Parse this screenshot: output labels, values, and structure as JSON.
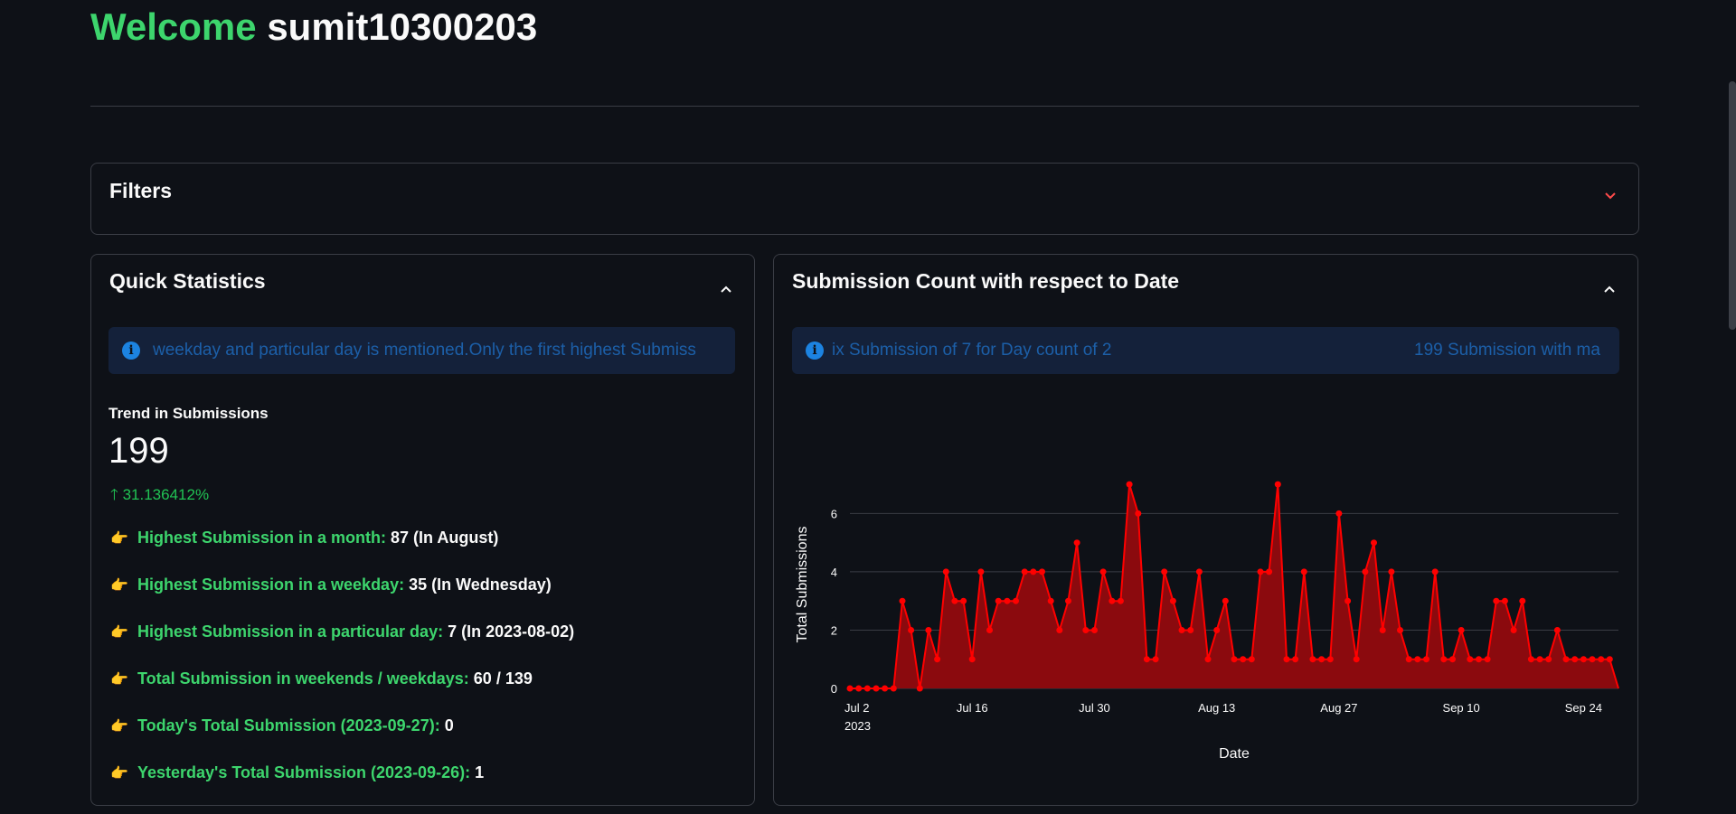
{
  "header": {
    "welcome": "Welcome",
    "username": "sumit10300203"
  },
  "filters": {
    "title": "Filters"
  },
  "quick_stats": {
    "title": "Quick Statistics",
    "info_text": "weekday and particular day is mentioned.Only the first highest Submiss",
    "metric_label": "Trend in Submissions",
    "metric_value": "199",
    "metric_delta": "31.136412%",
    "items": [
      {
        "label": "Highest Submission in a month:",
        "value": "87 (In August)"
      },
      {
        "label": "Highest Submission in a weekday:",
        "value": "35 (In Wednesday)"
      },
      {
        "label": "Highest Submission in a particular day:",
        "value": "7 (In 2023-08-02)"
      },
      {
        "label": "Total Submission in weekends / weekdays:",
        "value": "60 / 139"
      },
      {
        "label": "Today's Total Submission (2023-09-27):",
        "value": "0"
      },
      {
        "label": "Yesterday's Total Submission (2023-09-26):",
        "value": "1"
      }
    ]
  },
  "submission_chart": {
    "title": "Submission Count with respect to Date",
    "info_text_left": "ix Submission of 7 for Day count of 2",
    "info_text_right": "199 Submission with ma"
  },
  "chart_data": {
    "type": "area",
    "xlabel": "Date",
    "ylabel": "Total Submissions",
    "x_start": "2023-07-02",
    "x_ticks": [
      "Jul 2",
      "Jul 16",
      "Jul 30",
      "Aug 13",
      "Aug 27",
      "Sep 10",
      "Sep 24"
    ],
    "x_tick_year": "2023",
    "y_ticks": [
      "0",
      "2",
      "4",
      "6"
    ],
    "ylim": [
      0,
      7.5
    ],
    "color": "#ff0000",
    "fill_color": "#8b0a0e",
    "values": [
      0,
      0,
      0,
      0,
      0,
      0,
      3,
      2,
      0,
      2,
      1,
      4,
      3,
      3,
      1,
      4,
      2,
      3,
      3,
      3,
      4,
      4,
      4,
      3,
      2,
      3,
      5,
      2,
      2,
      4,
      3,
      3,
      7,
      6,
      1,
      1,
      4,
      3,
      2,
      2,
      4,
      1,
      2,
      3,
      1,
      1,
      1,
      4,
      4,
      7,
      1,
      1,
      4,
      1,
      1,
      1,
      6,
      3,
      1,
      4,
      5,
      2,
      4,
      2,
      1,
      1,
      1,
      4,
      1,
      1,
      2,
      1,
      1,
      1,
      3,
      3,
      2,
      3,
      1,
      1,
      1,
      2,
      1,
      1,
      1,
      1,
      1,
      1,
      0
    ]
  },
  "colors": {
    "background": "#0e1117",
    "accent_green": "#3dd56d",
    "delta_green": "#21c354",
    "info_blue": "#1c83e1",
    "chevron_red": "#ff4b4b"
  }
}
